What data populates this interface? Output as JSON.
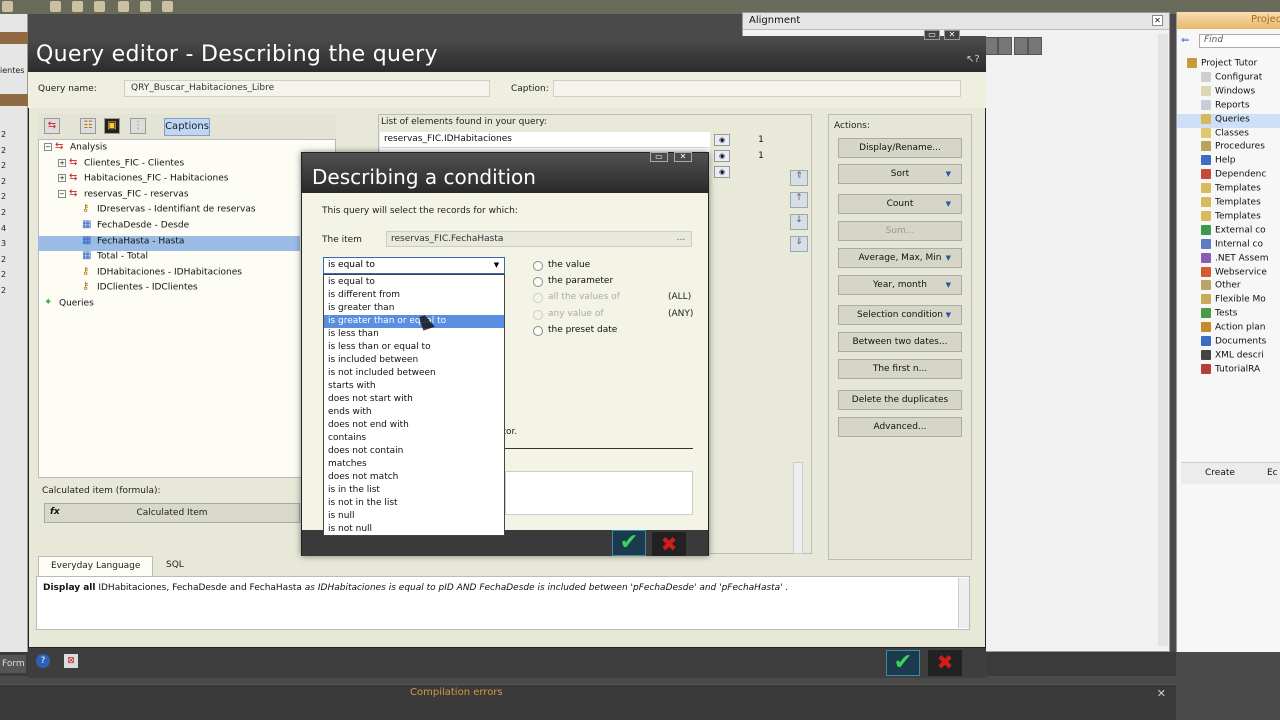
{
  "alignment": {
    "title": "Alignment"
  },
  "project": {
    "title": "Project",
    "find_placeholder": "Find",
    "items": [
      {
        "label": "Project Tutor",
        "color": "#c89b3a",
        "selected": false
      },
      {
        "label": "Configurat",
        "color": "#cfcfcf",
        "selected": false
      },
      {
        "label": "Windows",
        "color": "#ddd7b8",
        "selected": false
      },
      {
        "label": "Reports",
        "color": "#c6cfd9",
        "selected": false
      },
      {
        "label": "Queries",
        "color": "#d6b85c",
        "selected": true
      },
      {
        "label": "Classes",
        "color": "#e2c76c",
        "selected": false
      },
      {
        "label": "Procedures",
        "color": "#bba25a",
        "selected": false
      },
      {
        "label": "Help",
        "color": "#3b6ec2",
        "selected": false
      },
      {
        "label": "Dependenc",
        "color": "#c54a3a",
        "selected": false
      },
      {
        "label": "Templates",
        "color": "#d9b85e",
        "selected": false
      },
      {
        "label": "Templates",
        "color": "#d9b85e",
        "selected": false
      },
      {
        "label": "Templates",
        "color": "#d9b85e",
        "selected": false
      },
      {
        "label": "External co",
        "color": "#3b9a4e",
        "selected": false
      },
      {
        "label": "Internal co",
        "color": "#5b7bc2",
        "selected": false
      },
      {
        "label": ".NET Assem",
        "color": "#8b5ab5",
        "selected": false
      },
      {
        "label": "Webservice",
        "color": "#d35b2e",
        "selected": false
      },
      {
        "label": "Other",
        "color": "#b8a46a",
        "selected": false
      },
      {
        "label": "Flexible Mo",
        "color": "#c9a95a",
        "selected": false
      },
      {
        "label": "Tests",
        "color": "#4a9c4a",
        "selected": false
      },
      {
        "label": "Action plan",
        "color": "#c58a2a",
        "selected": false
      },
      {
        "label": "Documents",
        "color": "#3b6ec2",
        "selected": false
      },
      {
        "label": "XML descri",
        "color": "#444444",
        "selected": false
      },
      {
        "label": "TutorialRA",
        "color": "#b5403a",
        "selected": false
      }
    ],
    "foot_create": "Create",
    "foot_edit": "Ec"
  },
  "left_strip": {
    "label": "ientes",
    "numbers": [
      "2",
      "2",
      "2",
      "2",
      "2",
      "2",
      "4",
      "3",
      "2",
      "2",
      "2"
    ]
  },
  "query_editor": {
    "title": "Query editor - Describing the query",
    "query_name_label": "Query name:",
    "query_name_value": "QRY_Buscar_Habitaciones_Libre",
    "caption_label": "Caption:",
    "caption_value": "",
    "captions_button": "Captions",
    "tree": [
      {
        "label": "Analysis",
        "indent": 0,
        "icon": "analysis",
        "expander": "−",
        "selected": false
      },
      {
        "label": "Clientes_FIC  -  Clientes",
        "indent": 1,
        "icon": "table",
        "expander": "+",
        "selected": false
      },
      {
        "label": "Habitaciones_FIC  -  Habitaciones",
        "indent": 1,
        "icon": "table",
        "expander": "+",
        "selected": false
      },
      {
        "label": "reservas_FIC  -  reservas",
        "indent": 1,
        "icon": "table",
        "expander": "−",
        "selected": false
      },
      {
        "label": "IDreservas  -  Identifiant de reservas",
        "indent": 2,
        "icon": "key",
        "expander": "",
        "selected": false
      },
      {
        "label": "FechaDesde  -  Desde",
        "indent": 2,
        "icon": "field",
        "expander": "",
        "selected": false
      },
      {
        "label": "FechaHasta  -  Hasta",
        "indent": 2,
        "icon": "field",
        "expander": "",
        "selected": true
      },
      {
        "label": "Total  -  Total",
        "indent": 2,
        "icon": "field",
        "expander": "",
        "selected": false
      },
      {
        "label": "IDHabitaciones  -  IDHabitaciones",
        "indent": 2,
        "icon": "key",
        "expander": "",
        "selected": false
      },
      {
        "label": "IDClientes  -  IDClientes",
        "indent": 2,
        "icon": "key",
        "expander": "",
        "selected": false
      },
      {
        "label": "Queries",
        "indent": 0,
        "icon": "queries",
        "expander": "",
        "selected": false
      }
    ],
    "calculated_label": "Calculated item (formula):",
    "calculated_button": "Calculated Item",
    "fx": "fx",
    "elements_label": "List of elements found in your query:",
    "elements": [
      {
        "label": "reservas_FIC.IDHabitaciones",
        "count": "1"
      },
      {
        "label": "",
        "count": "1"
      },
      {
        "label": "",
        "count": ""
      }
    ],
    "actions_label": "Actions:",
    "actions": [
      {
        "label": "Display/Rename...",
        "dropdown": false,
        "disabled": false
      },
      {
        "label": "Sort",
        "dropdown": true,
        "disabled": false
      },
      {
        "label": "Count",
        "dropdown": true,
        "disabled": false
      },
      {
        "label": "Sum...",
        "dropdown": false,
        "disabled": true
      },
      {
        "label": "Average, Max, Min",
        "dropdown": true,
        "disabled": false
      },
      {
        "label": "Year, month",
        "dropdown": true,
        "disabled": false
      },
      {
        "label": "Selection condition",
        "dropdown": true,
        "disabled": false
      },
      {
        "label": "Between two dates...",
        "dropdown": false,
        "disabled": false
      },
      {
        "label": "The first n...",
        "dropdown": false,
        "disabled": false
      },
      {
        "label": "Delete the duplicates",
        "dropdown": false,
        "disabled": false
      },
      {
        "label": "Advanced...",
        "dropdown": false,
        "disabled": false
      }
    ],
    "tabs": [
      "Everyday Language",
      "SQL"
    ],
    "description": {
      "p1": "Display all",
      "p2": " IDHabitaciones, FechaDesde and FechaHasta ",
      "p3": " as IDHabitaciones  is equal to pID AND FechaDesde  is included between 'pFechaDesde' and 'pFechaHasta' ."
    }
  },
  "condition_dialog": {
    "title": "Describing a condition",
    "intro": "This query will select the records for which:",
    "item_label": "The item",
    "item_value": "reservas_FIC.FechaHasta",
    "item_more": "...",
    "selected_operator": "is equal to",
    "operators": [
      "is equal to",
      "is different from",
      "is greater than",
      "is greater than or equal to",
      "is less than",
      "is less than or equal to",
      "is included between",
      "is not included between",
      "starts with",
      "does not start with",
      "ends with",
      "does not end with",
      "contains",
      "does not contain",
      "matches",
      "does not match",
      "is in the list",
      "is not in the list",
      "is null",
      "is not null"
    ],
    "highlighted_index": 3,
    "options": [
      {
        "label": "the value",
        "disabled": false,
        "tag": ""
      },
      {
        "label": "the parameter",
        "disabled": false,
        "tag": ""
      },
      {
        "label": "all the values of",
        "disabled": true,
        "tag": "(ALL)"
      },
      {
        "label": "any value of",
        "disabled": true,
        "tag": "(ANY)"
      },
      {
        "label": "the preset date",
        "disabled": false,
        "tag": ""
      }
    ],
    "editor_text": "itor."
  },
  "compile": {
    "title": "Compilation errors"
  },
  "form_tab": "Form"
}
